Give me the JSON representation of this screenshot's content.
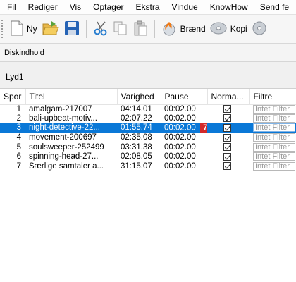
{
  "menu": {
    "items": [
      "Fil",
      "Rediger",
      "Vis",
      "Optager",
      "Ekstra",
      "Vindue",
      "KnowHow",
      "Send fe"
    ]
  },
  "toolbar": {
    "new_label": "Ny",
    "burn_label": "Brænd",
    "copy_label": "Kopi"
  },
  "section": {
    "label": "Diskindhold"
  },
  "tab": {
    "label": "Lyd1"
  },
  "table": {
    "headers": [
      "Spor",
      "Titel",
      "Varighed",
      "Pause",
      "Norma...",
      "Filtre"
    ],
    "rows": [
      {
        "spor": "1",
        "titel": "amalgam-217007",
        "varighed": "04:14.01",
        "pause": "00:02.00",
        "normalized": true,
        "filtre": "Intet Filter"
      },
      {
        "spor": "2",
        "titel": "bali-upbeat-motiv...",
        "varighed": "02:07.22",
        "pause": "00:02.00",
        "normalized": true,
        "filtre": "Intet Filter"
      },
      {
        "spor": "3",
        "titel": "night-detective-22...",
        "varighed": "01:55.74",
        "pause": "00:02.00",
        "normalized": true,
        "filtre": "Intet Filter",
        "marker": "7"
      },
      {
        "spor": "4",
        "titel": "movement-200697",
        "varighed": "02:35.08",
        "pause": "00:02.00",
        "normalized": true,
        "filtre": "Intet Filter"
      },
      {
        "spor": "5",
        "titel": "soulsweeper-252499",
        "varighed": "03:31.38",
        "pause": "00:02.00",
        "normalized": true,
        "filtre": "Intet Filter"
      },
      {
        "spor": "6",
        "titel": "spinning-head-27...",
        "varighed": "02:08.05",
        "pause": "00:02.00",
        "normalized": true,
        "filtre": "Intet Filter"
      },
      {
        "spor": "7",
        "titel": "Særlige samtaler a...",
        "varighed": "31:15.07",
        "pause": "00:02.00",
        "normalized": true,
        "filtre": "Intet Filter"
      }
    ],
    "selected_row": 2
  },
  "colors": {
    "selection": "#0a78d7",
    "marker": "#d32a2a"
  }
}
